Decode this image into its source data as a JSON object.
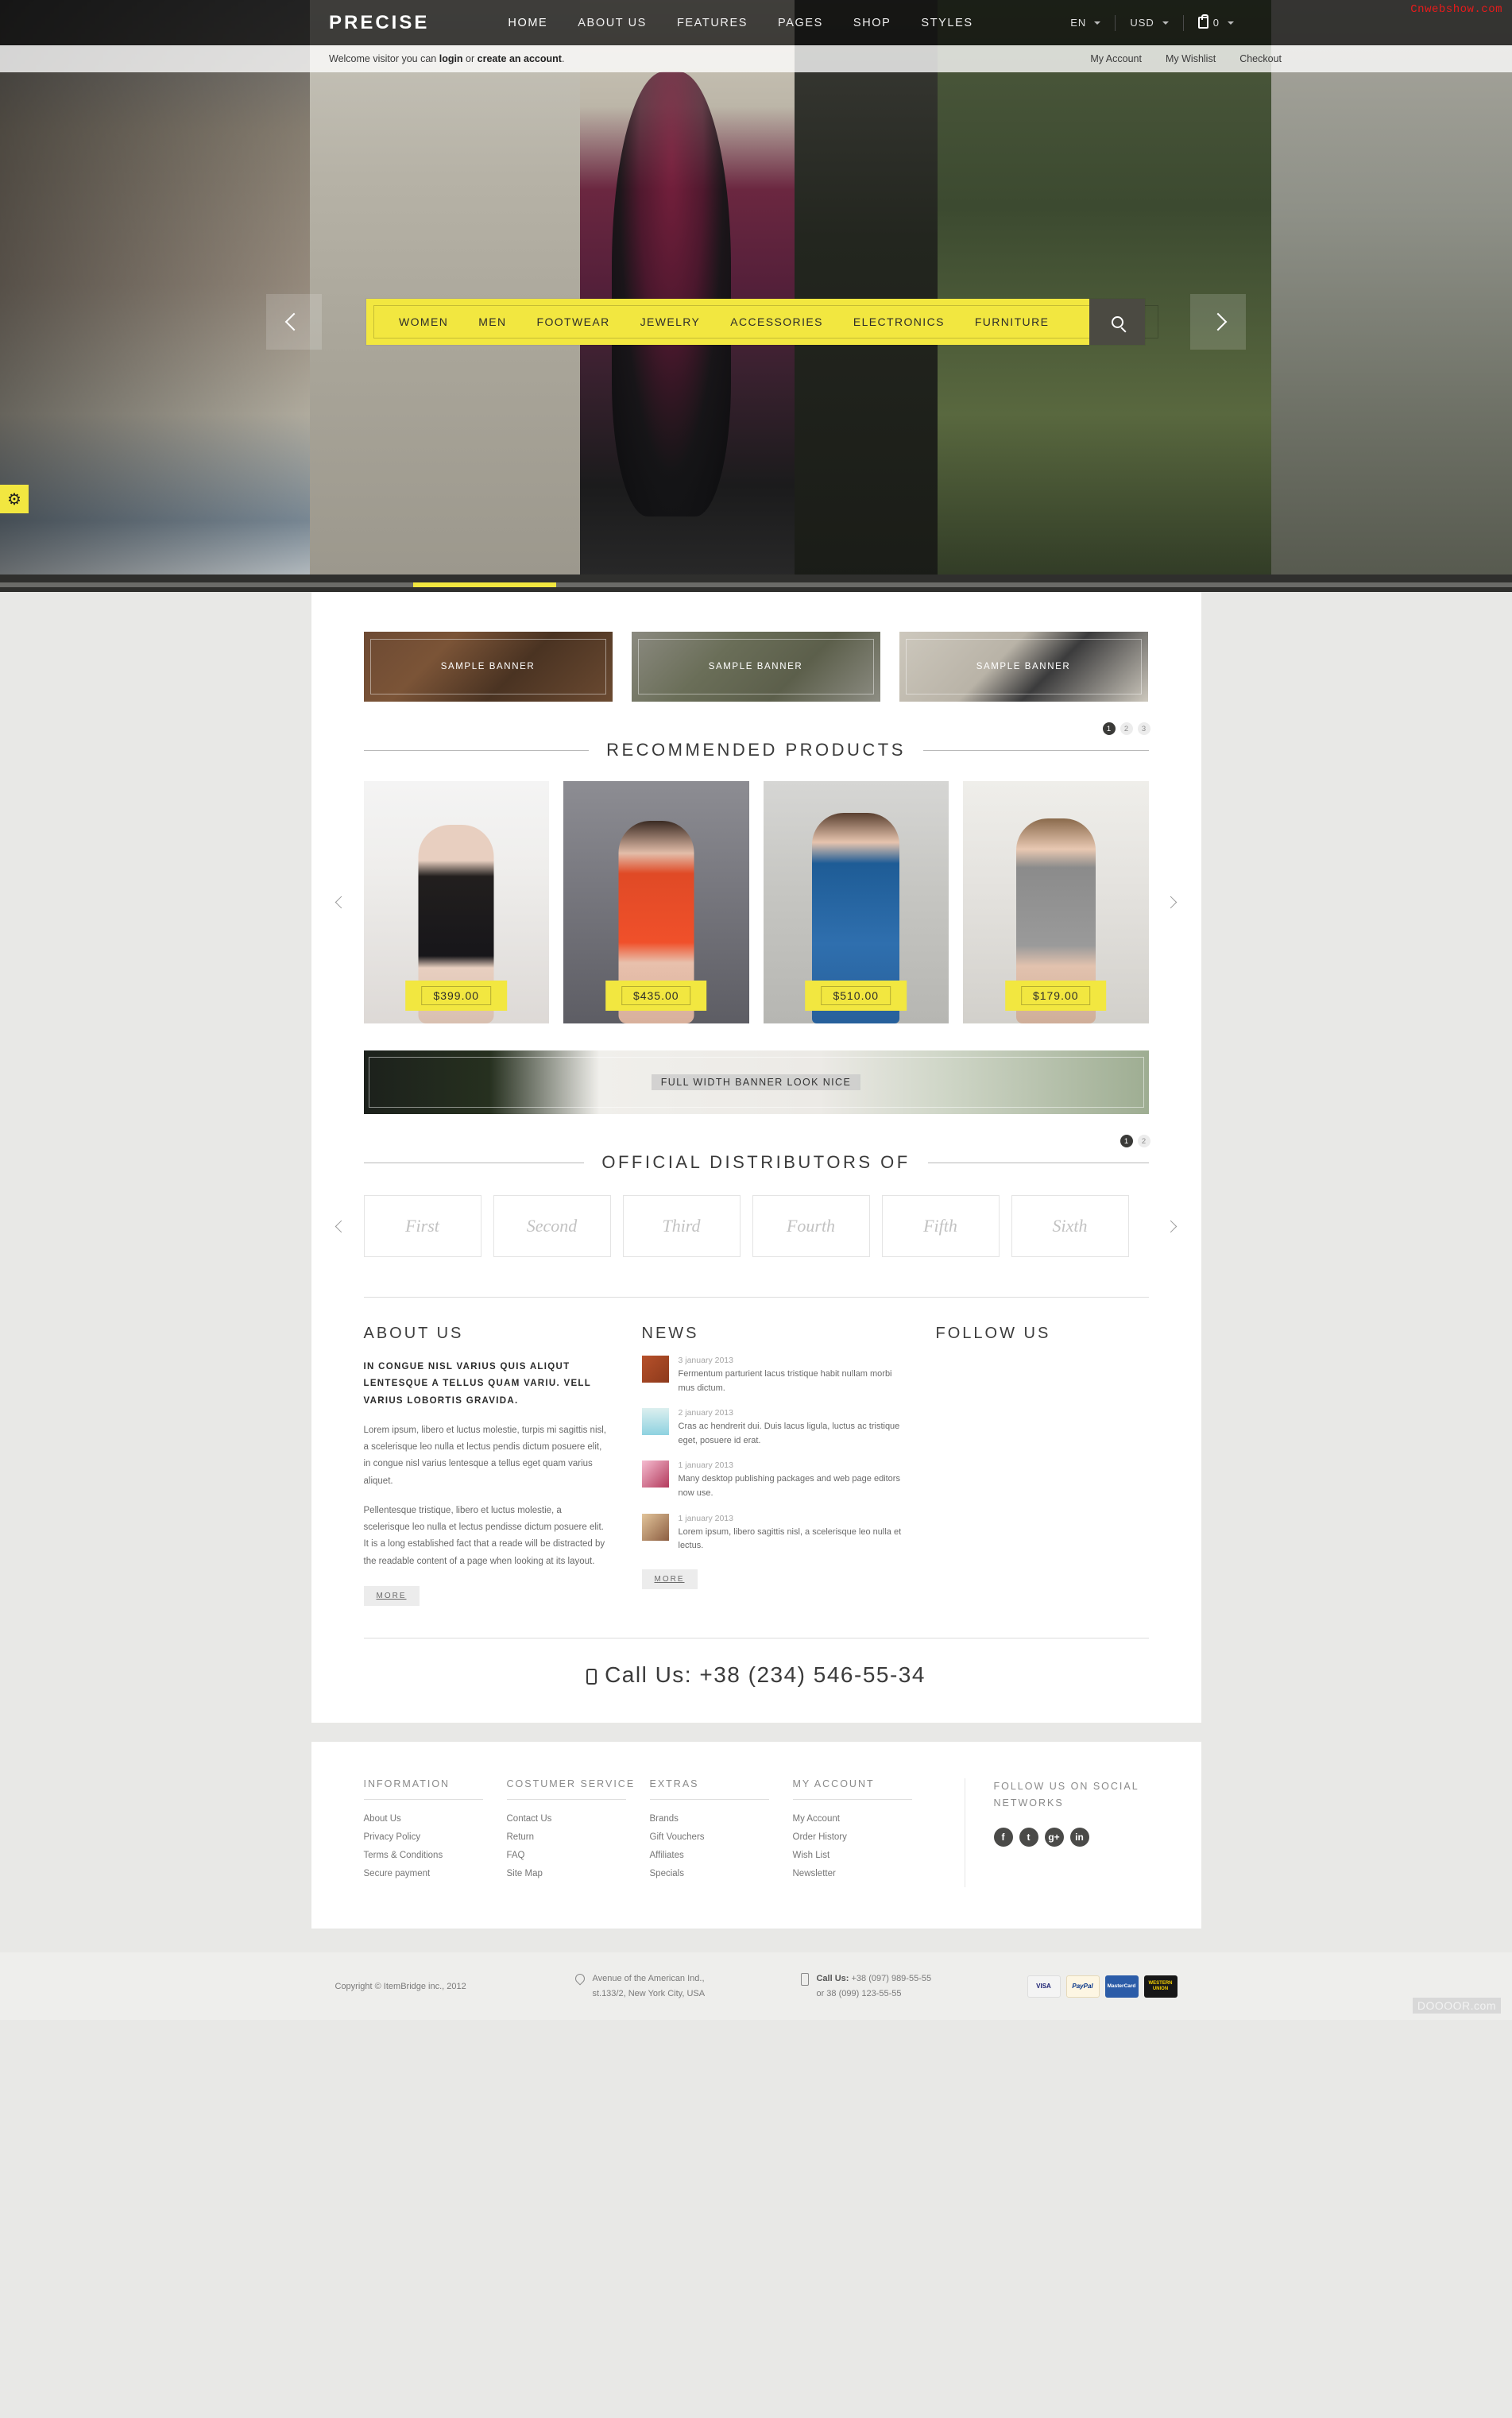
{
  "watermarks": {
    "top": "Cnwebshow.com",
    "bottom": "DOOOOR.com"
  },
  "header": {
    "logo": "PRECISE",
    "nav": [
      {
        "label": "HOME",
        "active": true
      },
      {
        "label": "ABOUT US",
        "active": false
      },
      {
        "label": "FEATURES",
        "active": false
      },
      {
        "label": "PAGES",
        "active": false
      },
      {
        "label": "SHOP",
        "active": false
      },
      {
        "label": "STYLES",
        "active": false
      }
    ],
    "language": "EN",
    "currency": "USD",
    "cart_count": "0"
  },
  "welcome": {
    "text_before": "Welcome visitor you can ",
    "login": "login",
    "text_mid": " or ",
    "create": "create an account",
    "text_after": ".",
    "links": [
      "My Account",
      "My Wishlist",
      "Checkout"
    ]
  },
  "categories": {
    "items": [
      "WOMEN",
      "MEN",
      "FOOTWEAR",
      "JEWELRY",
      "ACCESSORIES",
      "ELECTRONICS",
      "FURNITURE"
    ],
    "search_icon": "search-icon"
  },
  "banners": [
    {
      "label": "SAMPLE BANNER"
    },
    {
      "label": "SAMPLE BANNER"
    },
    {
      "label": "SAMPLE BANNER"
    }
  ],
  "recommended": {
    "title": "RECOMMENDED PRODUCTS",
    "pages": [
      "1",
      "2",
      "3"
    ],
    "active_page": "1",
    "products": [
      {
        "price": "$399.00"
      },
      {
        "price": "$435.00"
      },
      {
        "price": "$510.00"
      },
      {
        "price": "$179.00"
      }
    ]
  },
  "full_banner": {
    "label": "FULL WIDTH BANNER LOOK NICE"
  },
  "distributors": {
    "title": "OFFICIAL DISTRIBUTORS OF",
    "pages": [
      "1",
      "2"
    ],
    "active_page": "1",
    "items": [
      "First",
      "Second",
      "Third",
      "Fourth",
      "Fifth",
      "Sixth"
    ]
  },
  "about": {
    "title": "ABOUT US",
    "lead": "IN CONGUE NISL VARIUS QUIS ALIQUT LENTESQUE A TELLUS QUAM VARIU. VELL VARIUS LOBORTIS GRAVIDA.",
    "para1": "Lorem ipsum, libero et luctus molestie, turpis mi sagittis nisl, a scelerisque leo nulla et lectus pendis dictum posuere elit, in congue nisl varius lentesque a tellus eget quam varius aliquet.",
    "para2": "Pellentesque tristique, libero et luctus molestie, a scelerisque leo nulla et lectus pendisse dictum posuere elit. It is a long established fact that a reade will be distracted by the readable content of a page when looking at its layout.",
    "more": "MORE"
  },
  "news": {
    "title": "NEWS",
    "more": "MORE",
    "items": [
      {
        "date": "3 january 2013",
        "text": "Fermentum parturient lacus tristique habit nullam morbi mus dictum."
      },
      {
        "date": "2 january 2013",
        "text": "Cras ac hendrerit dui. Duis lacus ligula, luctus ac tristique eget, posuere id erat."
      },
      {
        "date": "1 january 2013",
        "text": "Many desktop publishing packages and web page editors now use."
      },
      {
        "date": "1 january 2013",
        "text": "Lorem ipsum, libero sagittis nisl, a scelerisque leo nulla et lectus."
      }
    ]
  },
  "follow": {
    "title": "FOLLOW US"
  },
  "call_us": {
    "text": "Call Us: +38 (234) 546-55-34"
  },
  "footer": {
    "columns": [
      {
        "title": "INFORMATION",
        "links": [
          "About Us",
          "Privacy Policy",
          "Terms & Conditions",
          "Secure payment"
        ]
      },
      {
        "title": "COSTUMER SERVICE",
        "links": [
          "Contact Us",
          "Return",
          "FAQ",
          "Site Map"
        ]
      },
      {
        "title": "EXTRAS",
        "links": [
          "Brands",
          "Gift Vouchers",
          "Affiliates",
          "Specials"
        ]
      },
      {
        "title": "MY ACCOUNT",
        "links": [
          "My Account",
          "Order History",
          "Wish List",
          "Newsletter"
        ]
      }
    ],
    "social": {
      "title": "FOLLOW US ON SOCIAL NETWORKS",
      "icons": [
        "facebook-icon",
        "twitter-icon",
        "google-plus-icon",
        "linkedin-icon"
      ],
      "glyphs": [
        "f",
        "t",
        "g+",
        "in"
      ]
    }
  },
  "bottom": {
    "copyright": "Copyright © ItemBridge inc., 2012",
    "address_line1": "Avenue of the American Ind.,",
    "address_line2": "st.133/2, New York City, USA",
    "call_label": "Call Us:",
    "call_line1": "+38 (097) 989-55-55",
    "call_line2": "or 38 (099) 123-55-55",
    "payments": [
      "VISA",
      "PayPal",
      "MasterCard",
      "WESTERN UNION"
    ]
  },
  "colors": {
    "accent_yellow": "#f2e740",
    "dark": "#2f2f2d",
    "text": "#6a6a6a"
  }
}
